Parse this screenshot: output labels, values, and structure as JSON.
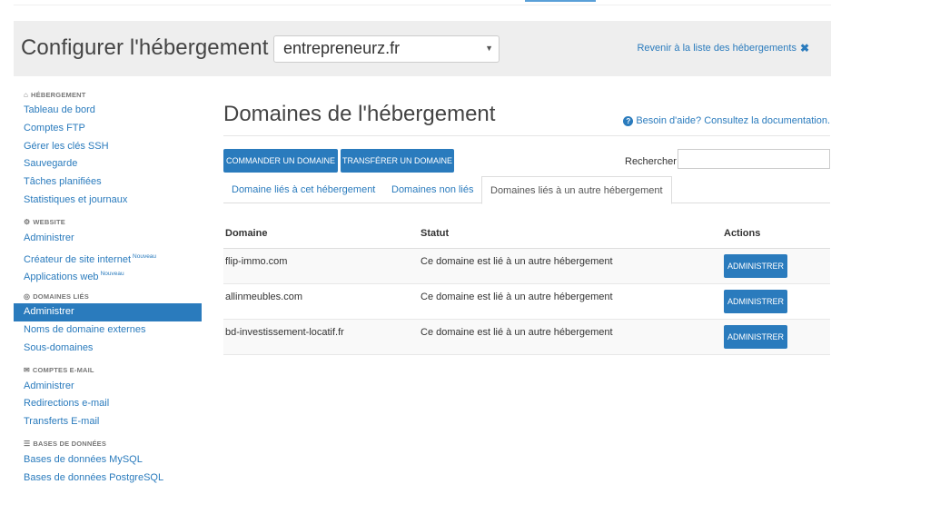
{
  "header": {
    "title": "Configurer l'hébergement",
    "selected_host": "entrepreneurz.fr",
    "back_link": "Revenir à la liste des hébergements",
    "back_icon": "close-icon"
  },
  "sidebar": {
    "sections": [
      {
        "heading": "HÉBERGEMENT",
        "icon": "home-icon",
        "items": [
          "Tableau de bord",
          "Comptes FTP",
          "Gérer les clés SSH",
          "Sauvegarde",
          "Tâches planifiées",
          "Statistiques et journaux"
        ]
      },
      {
        "heading": "WEBSITE",
        "icon": "gears-icon",
        "items": [
          "Administrer",
          "Créateur de site internet",
          "Applications web"
        ],
        "badge": "Nouveau"
      },
      {
        "heading": "DOMAINES LIÉS",
        "icon": "globe-icon",
        "items": [
          "Administrer",
          "Noms de domaine externes",
          "Sous-domaines"
        ]
      },
      {
        "heading": "COMPTES E-MAIL",
        "icon": "envelope-icon",
        "items": [
          "Administrer",
          "Redirections e-mail",
          "Transferts E-mail"
        ]
      },
      {
        "heading": "BASES DE DONNÉES",
        "icon": "database-icon",
        "items": [
          "Bases de données MySQL",
          "Bases de données PostgreSQL"
        ]
      }
    ]
  },
  "main": {
    "title": "Domaines de l'hébergement",
    "help": "Besoin d'aide? Consultez la documentation.",
    "buttons": {
      "order": "COMMANDER UN DOMAINE",
      "transfer": "TRANSFÉRER UN DOMAINE"
    },
    "search_label": "Rechercher",
    "tabs": [
      "Domaine liés à cet hébergement",
      "Domaines non liés",
      "Domaines liés à un autre hébergement"
    ],
    "table": {
      "headers": [
        "Domaine",
        "Statut",
        "Actions"
      ],
      "rows": [
        {
          "domain": "flip-immo.com",
          "status": "Ce domaine est lié à un autre hébergement",
          "action": "ADMINISTRER"
        },
        {
          "domain": "allinmeubles.com",
          "status": "Ce domaine est lié à un autre hébergement",
          "action": "ADMINISTRER"
        },
        {
          "domain": "bd-investissement-locatif.fr",
          "status": "Ce domaine est lié à un autre hébergement",
          "action": "ADMINISTRER"
        }
      ]
    }
  },
  "colors": {
    "accent": "#2a7bbd",
    "header_bg": "#eeeeee"
  }
}
